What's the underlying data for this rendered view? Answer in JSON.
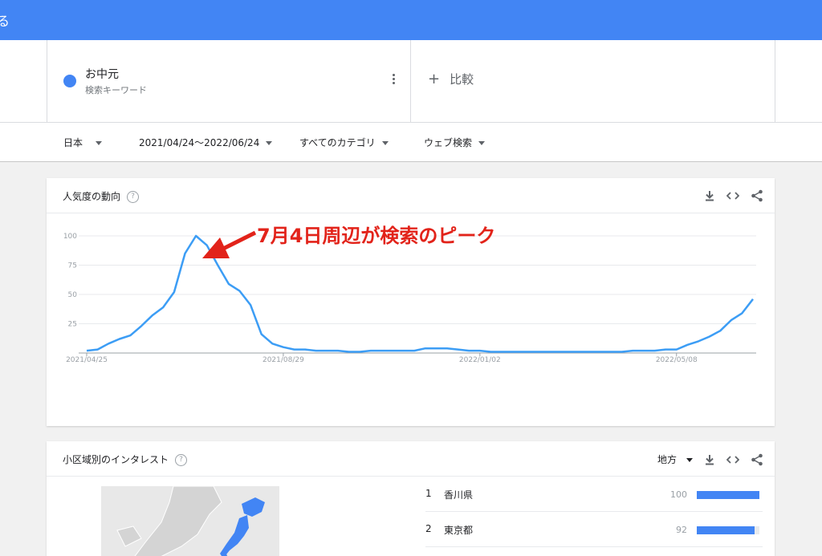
{
  "topbar": {
    "edge_glyph": "る"
  },
  "search_term": {
    "name": "お中元",
    "type": "検索キーワード",
    "color": "#4285f4"
  },
  "compare": {
    "label": "比較"
  },
  "filters": {
    "region": "日本",
    "date_range": "2021/04/24～2022/06/24",
    "category": "すべてのカテゴリ",
    "search_type": "ウェブ検索"
  },
  "trend_card": {
    "title": "人気度の動向",
    "icons": [
      "download-icon",
      "embed-icon",
      "share-icon"
    ]
  },
  "annotation": {
    "text": "7月4日周辺が検索のピーク",
    "color": "#e2231a"
  },
  "chart_data": {
    "type": "line",
    "xlabel": "",
    "ylabel": "",
    "ylim": [
      0,
      100
    ],
    "yticks": [
      25,
      50,
      75,
      100
    ],
    "x_tick_labels": [
      "2021/04/25",
      "2021/08/29",
      "2022/01/02",
      "2022/05/08"
    ],
    "x_tick_index": [
      0,
      18,
      36,
      54
    ],
    "grid": true,
    "color": "#3c9df5",
    "series": [
      {
        "values": [
          2,
          3,
          8,
          12,
          15,
          23,
          32,
          39,
          52,
          85,
          100,
          92,
          75,
          59,
          53,
          41,
          16,
          8,
          5,
          3,
          3,
          2,
          2,
          2,
          1,
          1,
          2,
          2,
          2,
          2,
          2,
          4,
          4,
          4,
          3,
          2,
          2,
          1,
          1,
          1,
          1,
          1,
          1,
          1,
          1,
          1,
          1,
          1,
          1,
          1,
          2,
          2,
          2,
          3,
          3,
          7,
          10,
          14,
          19,
          28,
          34,
          46
        ]
      }
    ]
  },
  "region_card": {
    "title": "小区域別のインタレスト",
    "resolution": "地方",
    "rows": [
      {
        "rank": "1",
        "name": "香川県",
        "value": 100
      },
      {
        "rank": "2",
        "name": "東京都",
        "value": 92
      }
    ]
  }
}
